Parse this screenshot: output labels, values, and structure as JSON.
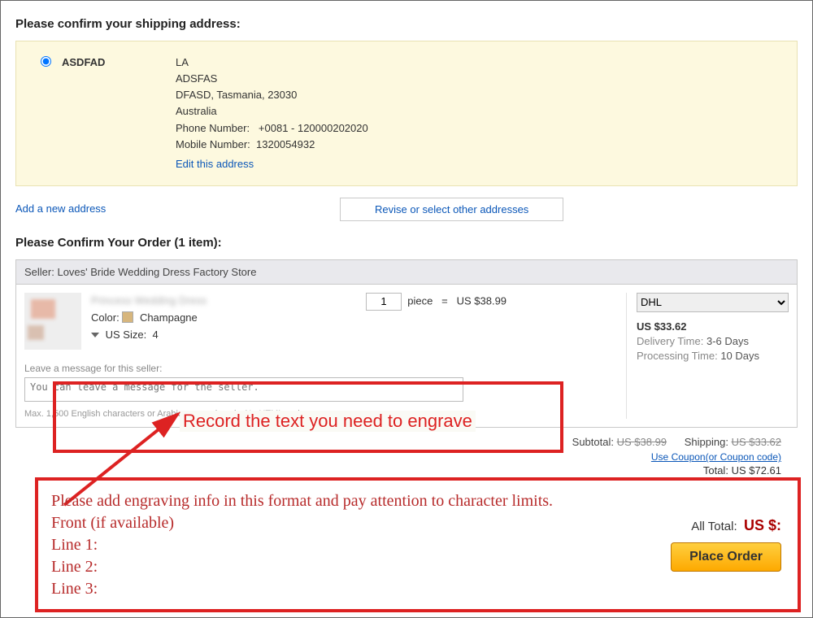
{
  "shipping": {
    "heading": "Please confirm your shipping address:",
    "name": "ASDFAD",
    "line1": "LA",
    "line2": "ADSFAS",
    "line3": "DFASD, Tasmania, 23030",
    "country": "Australia",
    "phone_label": "Phone Number:",
    "phone_value": "+0081 - 120000202020",
    "mobile_label": "Mobile Number:",
    "mobile_value": "1320054932",
    "edit_link": "Edit this address",
    "add_link": "Add a new address",
    "revise_btn": "Revise or select other addresses"
  },
  "order": {
    "heading": "Please Confirm Your Order (1 item):",
    "seller_label": "Seller: Loves' Bride Wedding Dress Factory Store",
    "product_title_blurred": "Princess Wedding Dress",
    "color_label": "Color:",
    "color_value": "Champagne",
    "size_label": "US Size:",
    "size_value": "4",
    "qty_value": "1",
    "piece_label": "piece",
    "eq": "=",
    "unit_price": "US $38.99"
  },
  "shipping_opt": {
    "carrier": "DHL",
    "cost": "US $33.62",
    "delivery_label": "Delivery Time:",
    "delivery_value": "3-6 Days",
    "processing_label": "Processing Time:",
    "processing_value": "10 Days"
  },
  "message": {
    "label": "Leave a message for this seller:",
    "placeholder": "You can leave a message for the seller.",
    "hint": "Max. 1,500 English characters or Arabic numerals only. No HTML codes."
  },
  "totals": {
    "subtotal_label": "Subtotal:",
    "subtotal_value": "US $38.99",
    "shipping_label": "Shipping:",
    "shipping_value": "US $33.62",
    "coupon": "Use Coupon(or Coupon code)",
    "total_label": "Total:",
    "total_value": "US $72.61",
    "all_total_label": "All Total:",
    "all_total_value": "US $:",
    "place_order": "Place Order"
  },
  "annotation": {
    "msg_arrow_text": "Record the text you need to engrave",
    "instruction_l1": "Please add engraving info in this format and pay attention to character limits.",
    "instruction_l2": "Front (if available)",
    "instruction_l3": "Line 1:",
    "instruction_l4": "Line 2:",
    "instruction_l5": "Line 3:"
  }
}
